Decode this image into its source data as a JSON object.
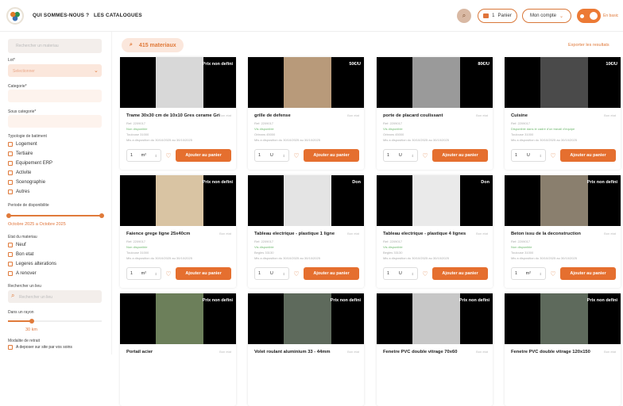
{
  "header": {
    "nav1": "QUI SOMMES-NOUS ?",
    "nav2": "LES CATALOGUES",
    "cart_count": "1",
    "cart_label": "Panier",
    "account_label": "Mon compte",
    "lang_label": "En basic"
  },
  "sidebar": {
    "search_placeholder": "Rechercher un materiau",
    "lot_label": "Lot*",
    "lot_placeholder": "Selectionner",
    "category_label": "Categorie*",
    "subcategory_label": "Sous categorie*",
    "building_label": "Typologie de batiment",
    "building_types": [
      "Logement",
      "Tertiaire",
      "Equipement ERP",
      "Activite",
      "Scenographie",
      "Autres"
    ],
    "period_label": "Periode de disponibilite",
    "period_value": "Octobre 2025 a Octobre 2025",
    "state_label": "Etat du materiau",
    "states": [
      "Neuf",
      "Bon etat",
      "Legeres alterations",
      "A renover"
    ],
    "place_label": "Rechercher un lieu",
    "place_placeholder": "Rechercher un lieu",
    "radius_label": "Dans un rayon",
    "radius_value": "30 km",
    "withdraw_label": "Modalite de retrait",
    "withdraw_option": "A deposer sur site par vos soins"
  },
  "main": {
    "count": "415 materiaux",
    "export": "Exporter les resultats"
  },
  "cards": [
    {
      "title": "Trame 30x30 cm de 10x10 Gres cerame Gris ...",
      "price": "Prix non defini",
      "state": "Bon etat",
      "qty": "1",
      "unit": "m²",
      "add": "Ajouter au panier",
      "ref": "Ref: 2209017",
      "avail": "Non disponible",
      "loc": "Toulouse 31000",
      "date": "Mis a disposition du 30/10/2025 au 30/10/2025",
      "color": "#d8d8d8"
    },
    {
      "title": "grille de defense",
      "price": "50€/U",
      "state": "Bon etat",
      "qty": "1",
      "unit": "U",
      "add": "Ajouter au panier",
      "ref": "Ref: 2209017",
      "avail": "Vis disponible",
      "loc": "Orleans 45000",
      "date": "Mis a disposition du 30/10/2025 au 30/10/2025",
      "color": "#b89a7a"
    },
    {
      "title": "porte de placard coulissant",
      "price": "80€/U",
      "state": "Bon etat",
      "qty": "1",
      "unit": "U",
      "add": "Ajouter au panier",
      "ref": "Ref: 2209017",
      "avail": "Vis disponible",
      "loc": "Orleans 45000",
      "date": "Mis a disposition du 30/10/2025 au 30/10/2025",
      "color": "#9a9a9a"
    },
    {
      "title": "Cuisine",
      "price": "10€/U",
      "state": "Bon etat",
      "qty": "1",
      "unit": "U",
      "add": "Ajouter au panier",
      "ref": "Ref: 2209017",
      "avail": "Disponible dans le cadre d'un travail d'equipe",
      "loc": "Toulouse 31000",
      "date": "Mis a disposition du 30/10/2025 au 30/10/2025",
      "color": "#4a4a4a"
    },
    {
      "title": "Faience grege ligne 25x40cm",
      "price": "Prix non defini",
      "state": "Bon etat",
      "qty": "1",
      "unit": "m²",
      "add": "Ajouter au panier",
      "ref": "Ref: 2209017",
      "avail": "Non disponible",
      "loc": "Toulouse 31000",
      "date": "Mis a disposition du 30/10/2025 au 30/10/2025",
      "color": "#d9c4a3"
    },
    {
      "title": "Tableau electrique - plastique 1 ligne",
      "price": "Don",
      "state": "Bon etat",
      "qty": "1",
      "unit": "U",
      "add": "Ajouter au panier",
      "ref": "Ref: 2209017",
      "avail": "Vis disponible",
      "loc": "Begles 33130",
      "date": "Mis a disposition du 30/10/2025 au 30/10/2025",
      "color": "#e4e4e4"
    },
    {
      "title": "Tableau electrique - plastique 4 lignes",
      "price": "Don",
      "state": "Bon etat",
      "qty": "1",
      "unit": "U",
      "add": "Ajouter au panier",
      "ref": "Ref: 2209017",
      "avail": "Vis disponible",
      "loc": "Begles 33130",
      "date": "Mis a disposition du 30/10/2025 au 30/10/2025",
      "color": "#eaeaea"
    },
    {
      "title": "Beton issu de la deconstruction",
      "price": "Prix non defini",
      "state": "Bon etat",
      "qty": "1",
      "unit": "m²",
      "add": "Ajouter au panier",
      "ref": "Ref: 2209017",
      "avail": "Non disponible",
      "loc": "Toulouse 31000",
      "date": "Mis a disposition du 30/10/2025 au 30/10/2025",
      "color": "#8a7f6e"
    },
    {
      "title": "Portail acier",
      "price": "Prix non defini",
      "state": "Bon etat",
      "qty": "",
      "unit": "",
      "add": "",
      "ref": "",
      "avail": "",
      "loc": "",
      "date": "",
      "color": "#6c7f5a"
    },
    {
      "title": "Volet roulant aluminium 33 - 44mm",
      "price": "Prix non defini",
      "state": "Bon etat",
      "qty": "",
      "unit": "",
      "add": "",
      "ref": "",
      "avail": "",
      "loc": "",
      "date": "",
      "color": "#5e6a5c"
    },
    {
      "title": "Fenetre PVC double vitrage 70x60",
      "price": "Prix non defini",
      "state": "Bon etat",
      "qty": "",
      "unit": "",
      "add": "",
      "ref": "",
      "avail": "",
      "loc": "",
      "date": "",
      "color": "#c7c7c7"
    },
    {
      "title": "Fenetre PVC double vitrage 120x150",
      "price": "Prix non defini",
      "state": "Bon etat",
      "qty": "",
      "unit": "",
      "add": "",
      "ref": "",
      "avail": "",
      "loc": "",
      "date": "",
      "color": "#5e6a5c"
    }
  ]
}
